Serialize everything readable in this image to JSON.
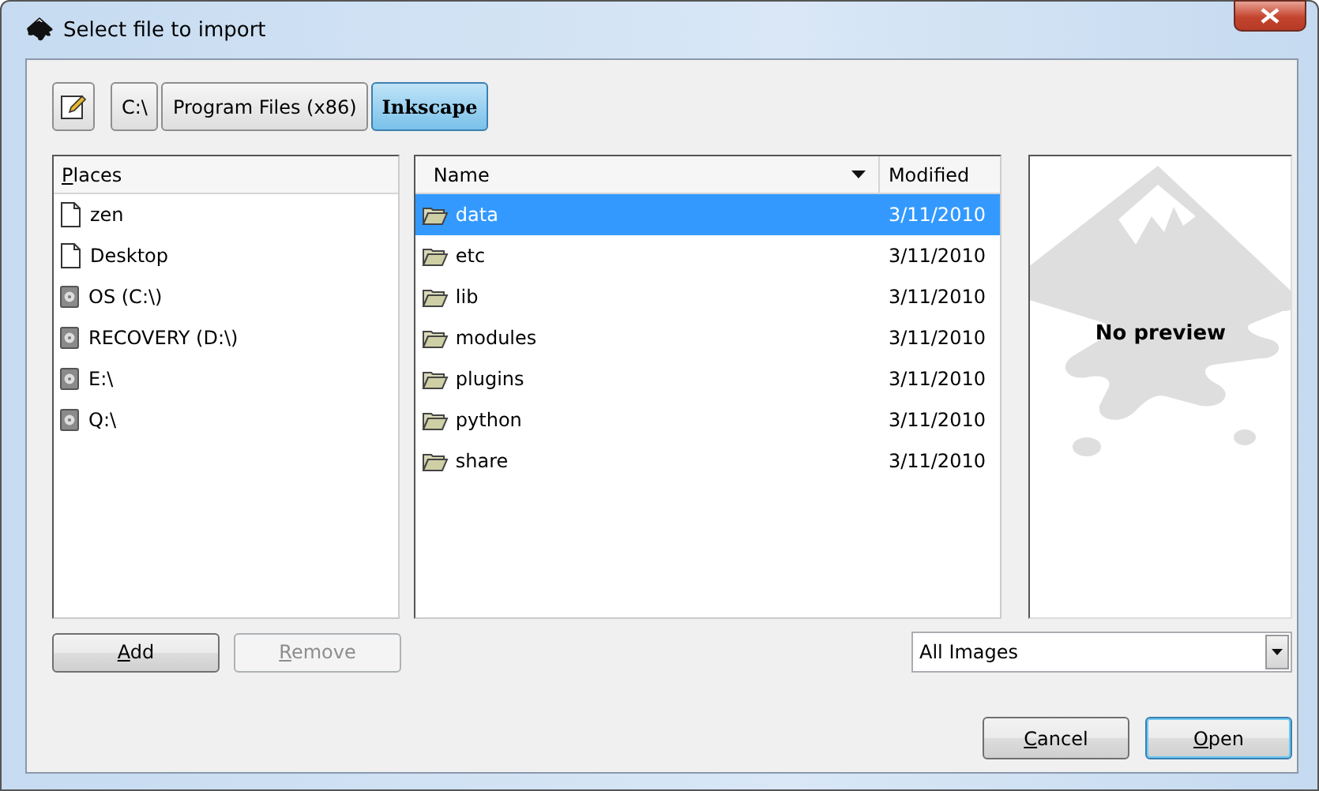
{
  "window": {
    "title": "Select file to import"
  },
  "path_bar": {
    "buttons": [
      {
        "label": "C:\\",
        "selected": false
      },
      {
        "label": "Program Files (x86)",
        "selected": false
      },
      {
        "label": "Inkscape",
        "selected": true
      }
    ]
  },
  "places": {
    "header": "Places",
    "header_mnemonic": true,
    "items": [
      {
        "label": "zen",
        "kind": "file"
      },
      {
        "label": "Desktop",
        "kind": "file"
      },
      {
        "label": "OS (C:\\)",
        "kind": "drive"
      },
      {
        "label": "RECOVERY (D:\\)",
        "kind": "drive"
      },
      {
        "label": "E:\\",
        "kind": "drive"
      },
      {
        "label": "Q:\\",
        "kind": "drive"
      }
    ]
  },
  "files": {
    "columns": [
      "Name",
      "Modified"
    ],
    "rows": [
      {
        "name": "data",
        "modified": "3/11/2010",
        "selected": true
      },
      {
        "name": "etc",
        "modified": "3/11/2010",
        "selected": false
      },
      {
        "name": "lib",
        "modified": "3/11/2010",
        "selected": false
      },
      {
        "name": "modules",
        "modified": "3/11/2010",
        "selected": false
      },
      {
        "name": "plugins",
        "modified": "3/11/2010",
        "selected": false
      },
      {
        "name": "python",
        "modified": "3/11/2010",
        "selected": false
      },
      {
        "name": "share",
        "modified": "3/11/2010",
        "selected": false
      }
    ]
  },
  "preview": {
    "text": "No preview"
  },
  "place_buttons": [
    {
      "label": "Add",
      "disabled": false
    },
    {
      "label": "Remove",
      "disabled": true
    }
  ],
  "filter": {
    "value": "All Images"
  },
  "dialog_buttons": [
    {
      "label": "Cancel",
      "default": false
    },
    {
      "label": "Open",
      "default": true
    }
  ]
}
